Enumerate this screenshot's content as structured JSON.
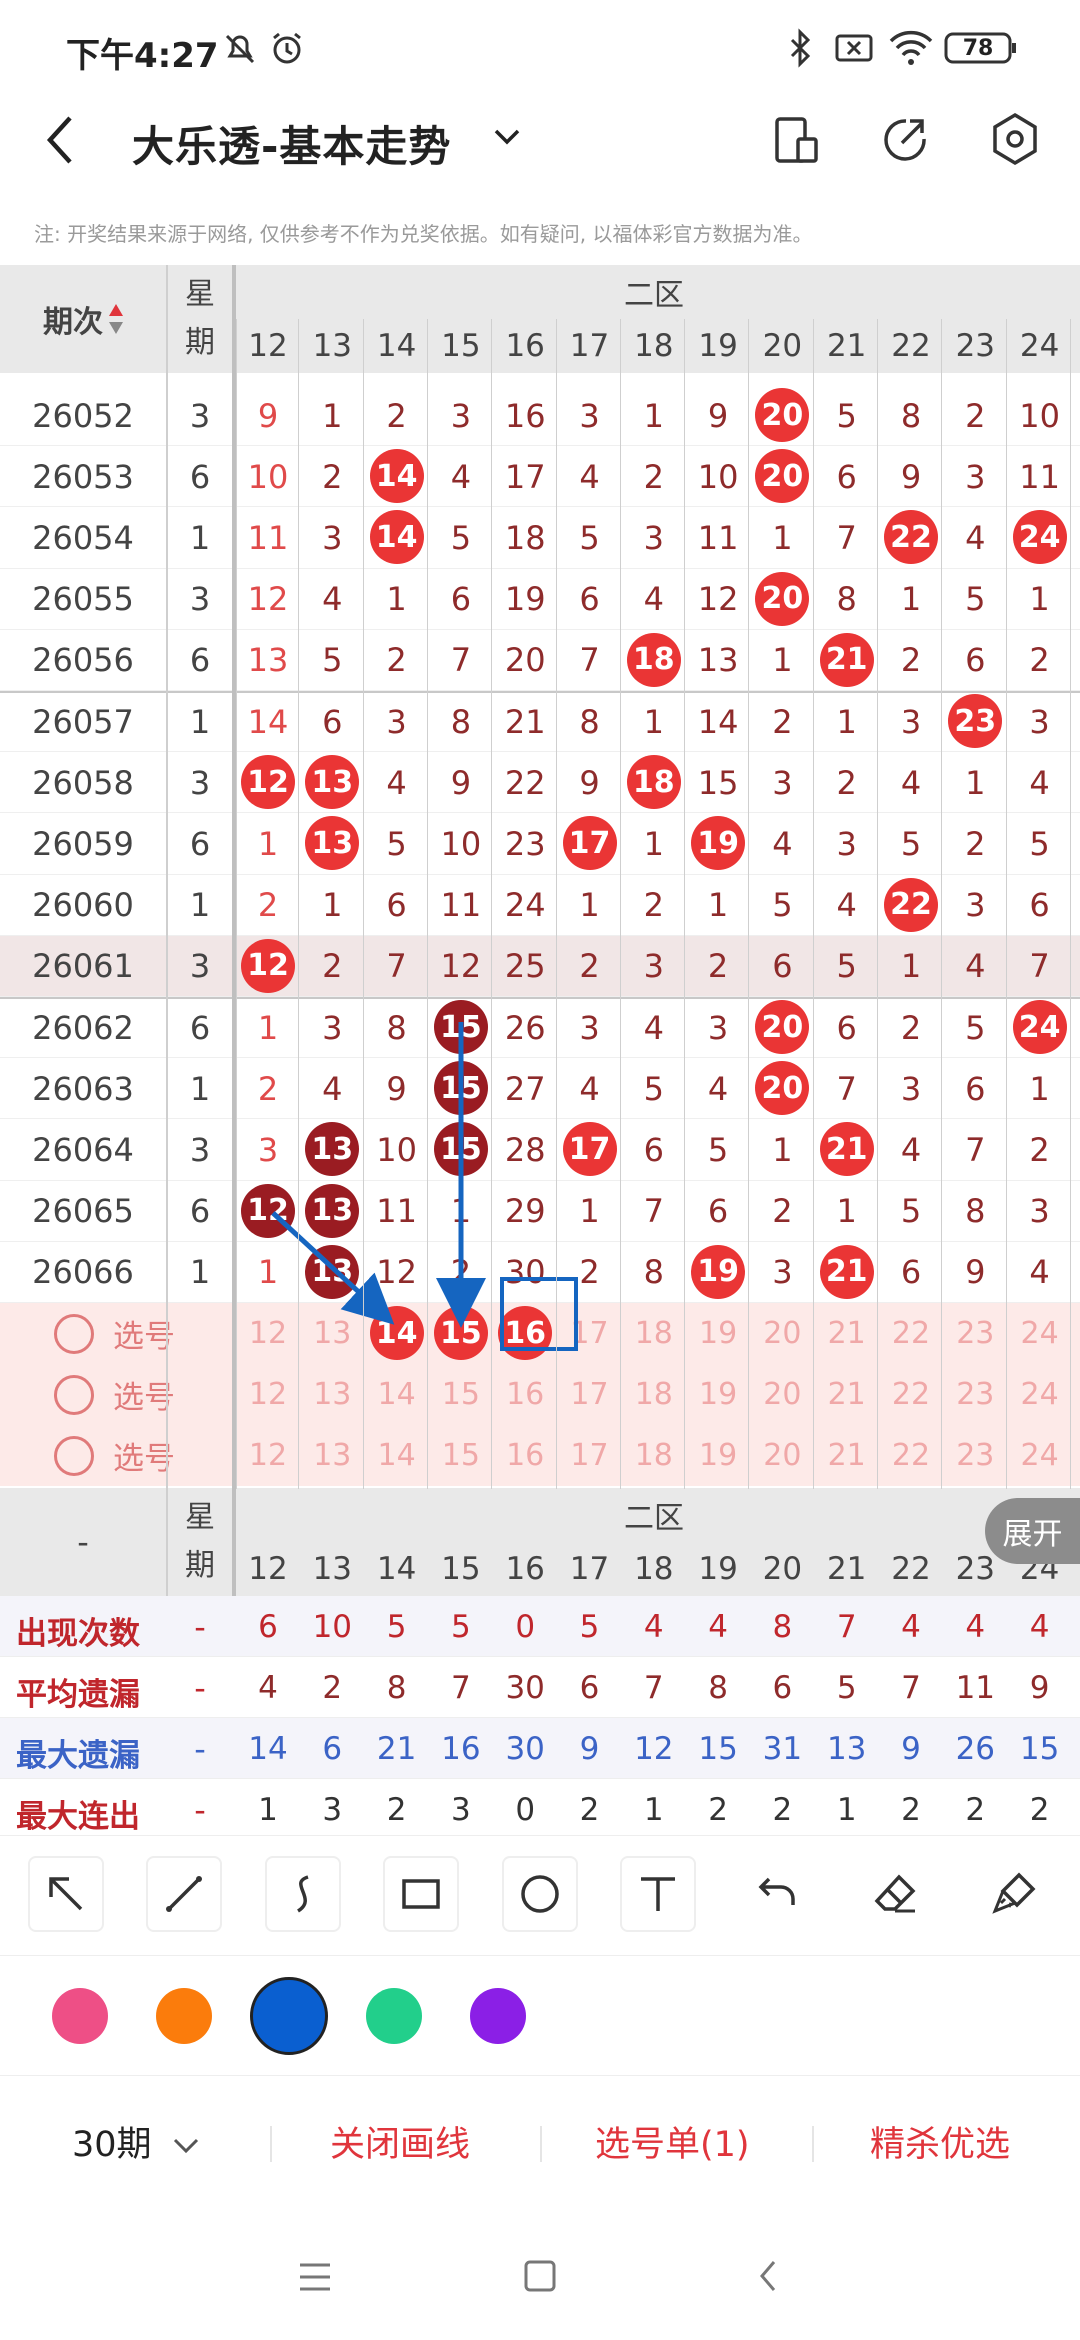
{
  "status_bar": {
    "time": "下午4:27",
    "battery": "78"
  },
  "header": {
    "title": "大乐透-基本走势"
  },
  "note": "注: 开奖结果来源于网络, 仅供参考不作为兑奖依据。如有疑问, 以福体彩官方数据为准。",
  "table": {
    "col_issue": "期次",
    "col_week": "星\n期",
    "zone_label": "二区",
    "numbers": [
      "12",
      "13",
      "14",
      "15",
      "16",
      "17",
      "18",
      "19",
      "20",
      "21",
      "22",
      "23",
      "24"
    ],
    "rows": [
      {
        "issue": "26052",
        "week": "3",
        "cells": [
          "9",
          "1",
          "2",
          "3",
          "16",
          "3",
          "1",
          "9",
          "20",
          "5",
          "8",
          "2",
          "10"
        ]
      },
      {
        "issue": "26053",
        "week": "6",
        "cells": [
          "10",
          "2",
          "14",
          "4",
          "17",
          "4",
          "2",
          "10",
          "20",
          "6",
          "9",
          "3",
          "11"
        ]
      },
      {
        "issue": "26054",
        "week": "1",
        "cells": [
          "11",
          "3",
          "14",
          "5",
          "18",
          "5",
          "3",
          "11",
          "1",
          "7",
          "22",
          "4",
          "24"
        ]
      },
      {
        "issue": "26055",
        "week": "3",
        "cells": [
          "12",
          "4",
          "1",
          "6",
          "19",
          "6",
          "4",
          "12",
          "20",
          "8",
          "1",
          "5",
          "1"
        ]
      },
      {
        "issue": "26056",
        "week": "6",
        "cells": [
          "13",
          "5",
          "2",
          "7",
          "20",
          "7",
          "18",
          "13",
          "1",
          "21",
          "2",
          "6",
          "2"
        ]
      },
      {
        "issue": "26057",
        "week": "1",
        "cells": [
          "14",
          "6",
          "3",
          "8",
          "21",
          "8",
          "1",
          "14",
          "2",
          "1",
          "3",
          "23",
          "3"
        ]
      },
      {
        "issue": "26058",
        "week": "3",
        "cells": [
          "12",
          "13",
          "4",
          "9",
          "22",
          "9",
          "18",
          "15",
          "3",
          "2",
          "4",
          "1",
          "4"
        ]
      },
      {
        "issue": "26059",
        "week": "6",
        "cells": [
          "1",
          "13",
          "5",
          "10",
          "23",
          "17",
          "1",
          "19",
          "4",
          "3",
          "5",
          "2",
          "5"
        ]
      },
      {
        "issue": "26060",
        "week": "1",
        "cells": [
          "2",
          "1",
          "6",
          "11",
          "24",
          "1",
          "2",
          "1",
          "5",
          "4",
          "22",
          "3",
          "6"
        ]
      },
      {
        "issue": "26061",
        "week": "3",
        "cells": [
          "12",
          "2",
          "7",
          "12",
          "25",
          "2",
          "3",
          "2",
          "6",
          "5",
          "1",
          "4",
          "7"
        ]
      },
      {
        "issue": "26062",
        "week": "6",
        "cells": [
          "1",
          "3",
          "8",
          "15",
          "26",
          "3",
          "4",
          "3",
          "20",
          "6",
          "2",
          "5",
          "24"
        ]
      },
      {
        "issue": "26063",
        "week": "1",
        "cells": [
          "2",
          "4",
          "9",
          "15",
          "27",
          "4",
          "5",
          "4",
          "20",
          "7",
          "3",
          "6",
          "1"
        ]
      },
      {
        "issue": "26064",
        "week": "3",
        "cells": [
          "3",
          "13",
          "10",
          "15",
          "28",
          "17",
          "6",
          "5",
          "1",
          "21",
          "4",
          "7",
          "2"
        ]
      },
      {
        "issue": "26065",
        "week": "6",
        "cells": [
          "12",
          "13",
          "11",
          "1",
          "29",
          "1",
          "7",
          "6",
          "2",
          "1",
          "5",
          "8",
          "3"
        ]
      },
      {
        "issue": "26066",
        "week": "1",
        "cells": [
          "1",
          "13",
          "12",
          "2",
          "30",
          "2",
          "8",
          "19",
          "3",
          "21",
          "6",
          "9",
          "4"
        ]
      }
    ],
    "select_label": "选号",
    "stats_dash": "-",
    "stats": [
      {
        "label": "出现次数",
        "dash": "-",
        "values": [
          "6",
          "10",
          "5",
          "5",
          "0",
          "5",
          "4",
          "4",
          "8",
          "7",
          "4",
          "4",
          "4"
        ]
      },
      {
        "label": "平均遗漏",
        "dash": "-",
        "values": [
          "4",
          "2",
          "8",
          "7",
          "30",
          "6",
          "7",
          "8",
          "6",
          "5",
          "7",
          "11",
          "9"
        ]
      },
      {
        "label": "最大遗漏",
        "dash": "-",
        "values": [
          "14",
          "6",
          "21",
          "16",
          "30",
          "9",
          "12",
          "15",
          "31",
          "13",
          "9",
          "26",
          "15"
        ]
      },
      {
        "label": "最大连出",
        "dash": "-",
        "values": [
          "1",
          "3",
          "2",
          "3",
          "0",
          "2",
          "1",
          "2",
          "2",
          "1",
          "2",
          "2",
          "2"
        ]
      }
    ],
    "expand_label": "展开"
  },
  "palette": {
    "colors": [
      "#ee4f86",
      "#fb7c0c",
      "#0a5fd0",
      "#22cf8b",
      "#8b1fe6"
    ],
    "selected_index": 2
  },
  "bottom_bar": {
    "period": "30期",
    "close_draw": "关闭画线",
    "selection_list": "选号单(1)",
    "precise_kill": "精杀优选"
  },
  "colors": {
    "red_ball": "#ea3535",
    "dark_ball": "#9a1c22",
    "accent_red": "#e0353c",
    "stat_blue": "#3b63c6",
    "stat_red": "#c0262c",
    "arrow_blue": "#1565c0"
  }
}
